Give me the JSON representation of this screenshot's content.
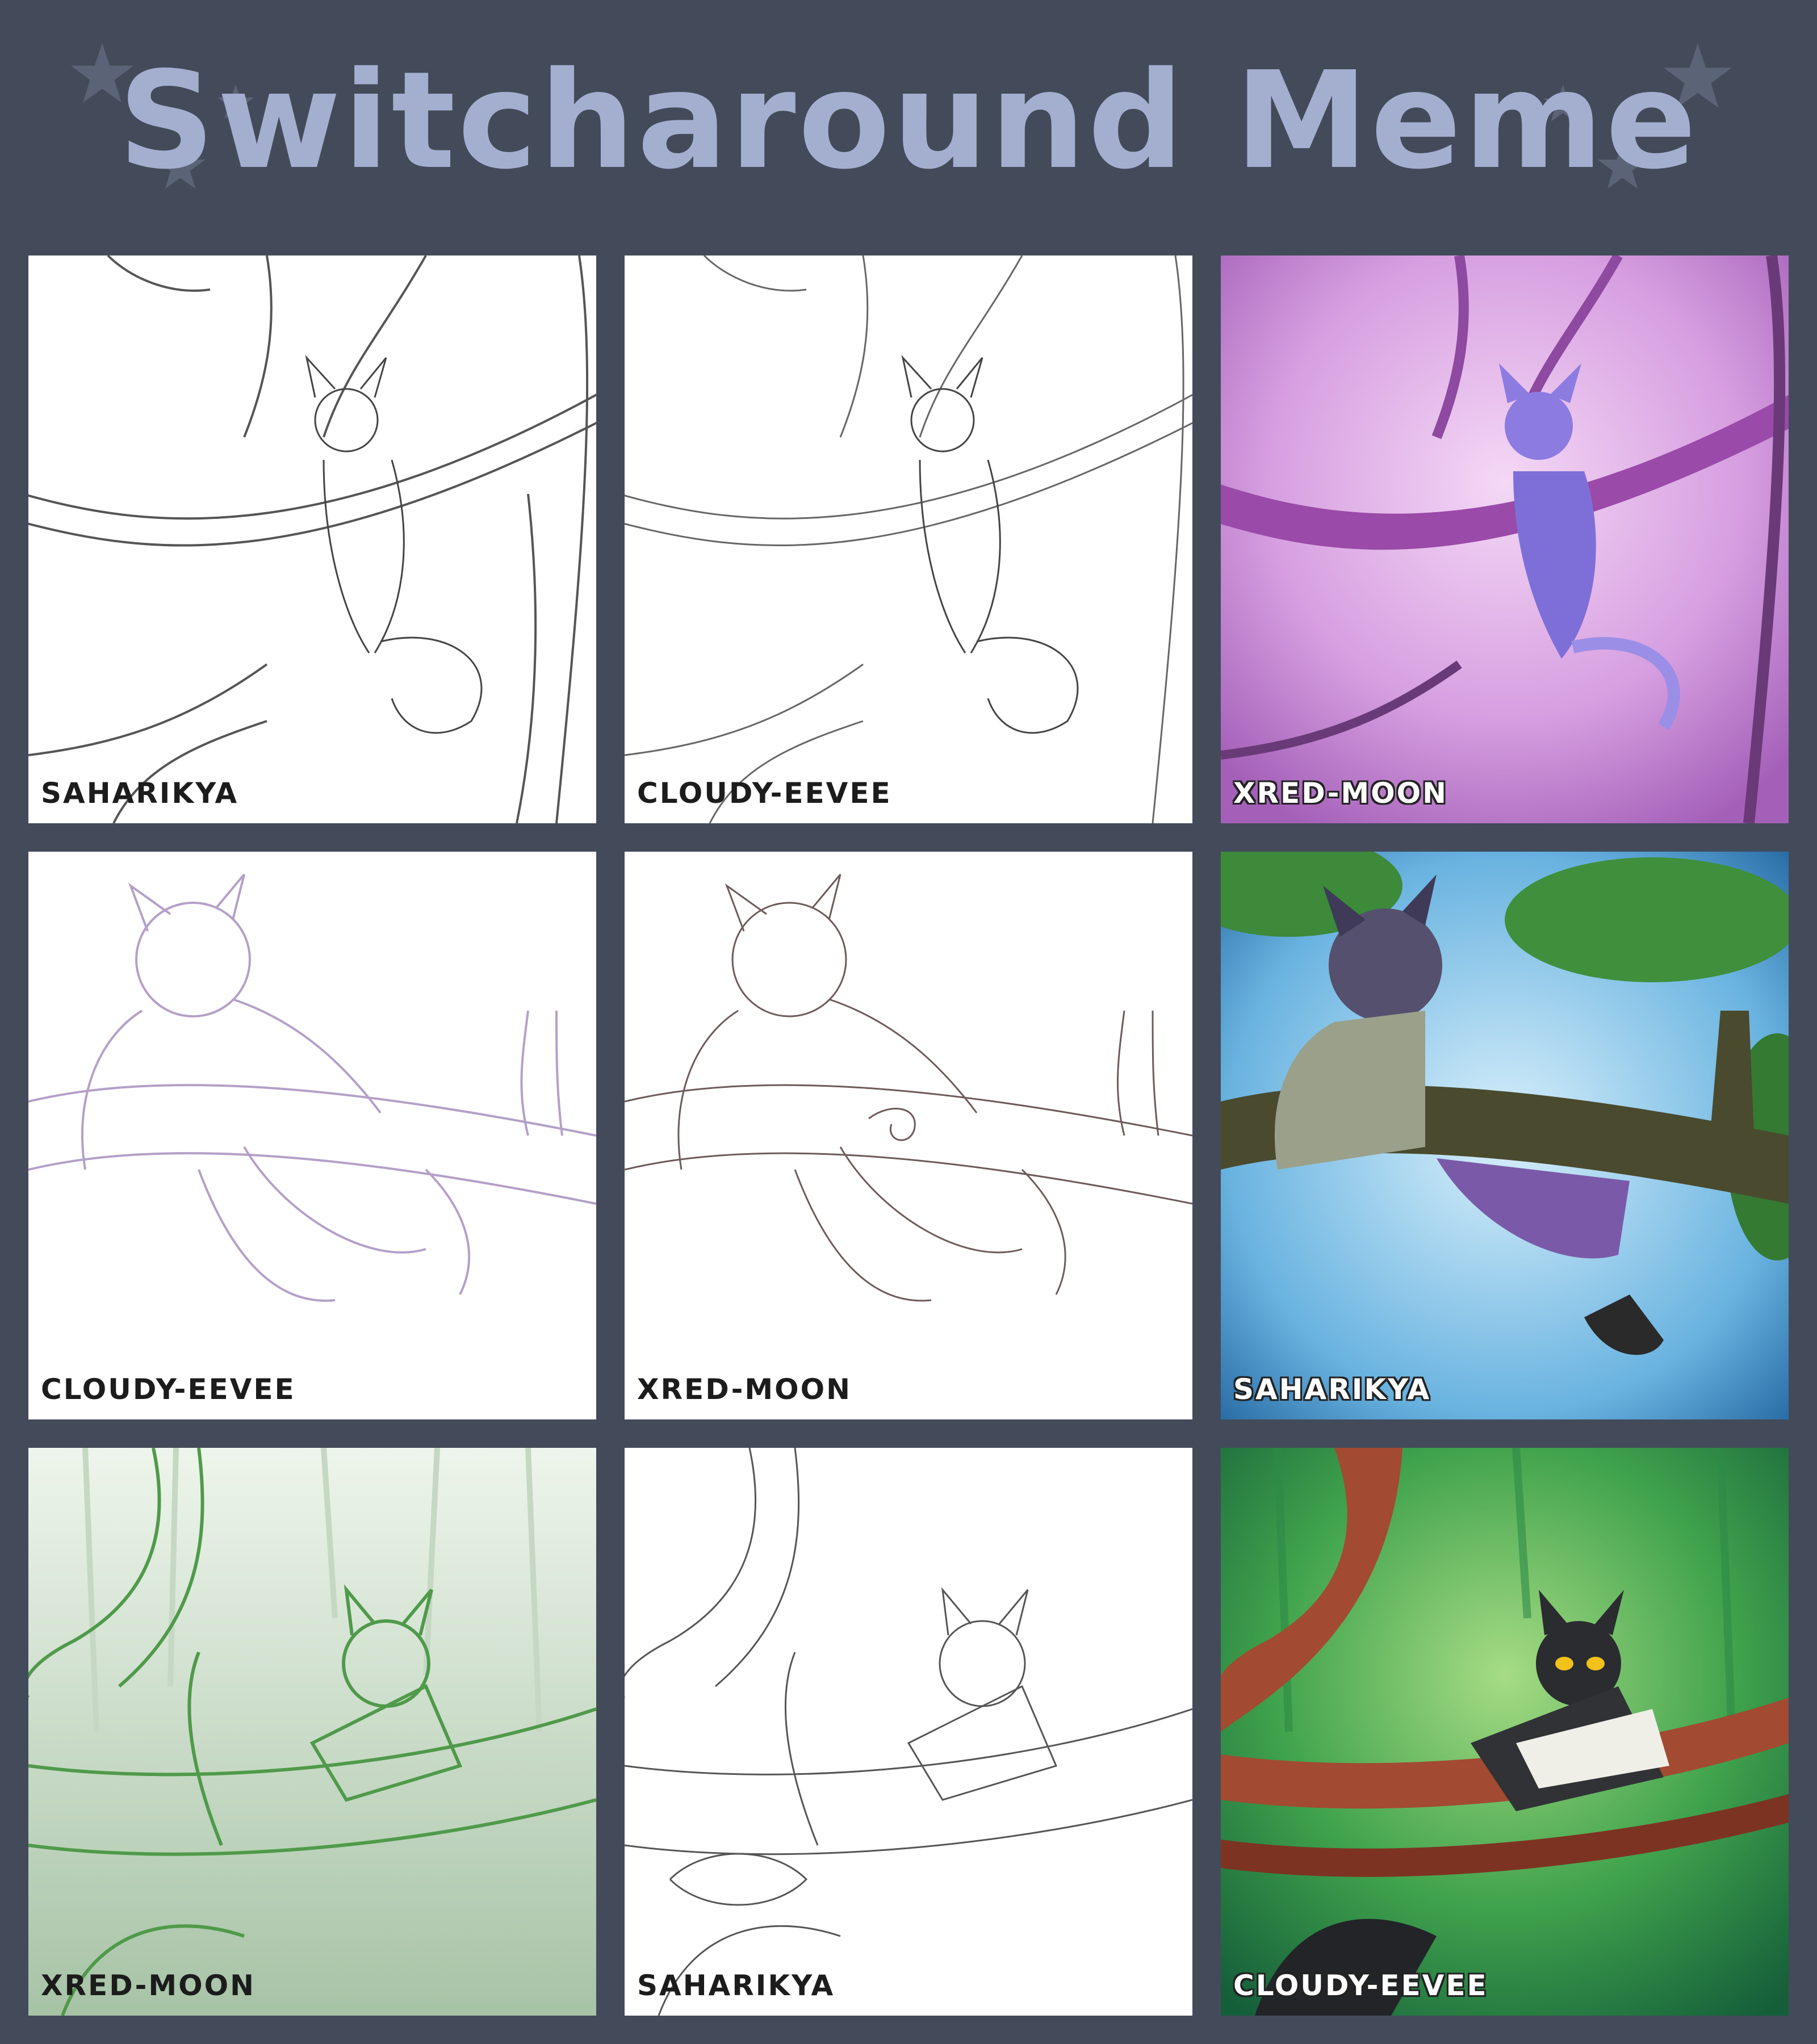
{
  "title": "Switcharound Meme",
  "colors": {
    "background": "#434b5a",
    "title": "#a4afd0",
    "stars": "#5b6477"
  },
  "panels": [
    {
      "label": "SAHARIKYA",
      "style": "sketch"
    },
    {
      "label": "CLOUDY-EEVEE",
      "style": "lineart"
    },
    {
      "label": "XRED-MOON",
      "style": "colored-pink"
    },
    {
      "label": "CLOUDY-EEVEE",
      "style": "sketch-purple"
    },
    {
      "label": "XRED-MOON",
      "style": "lineart"
    },
    {
      "label": "SAHARIKYA",
      "style": "colored-blue"
    },
    {
      "label": "XRED-MOON",
      "style": "sketch-green"
    },
    {
      "label": "SAHARIKYA",
      "style": "lineart"
    },
    {
      "label": "CLOUDY-EEVEE",
      "style": "colored-green"
    }
  ]
}
